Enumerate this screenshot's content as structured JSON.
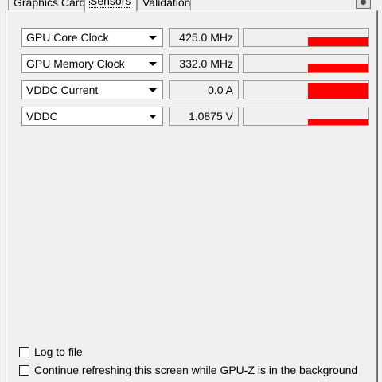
{
  "tabs": [
    {
      "label": "Graphics Card"
    },
    {
      "label": "Sensors"
    },
    {
      "label": "Validation"
    }
  ],
  "toolbar": {
    "screenshot_icon": "camera-icon"
  },
  "sensors": [
    {
      "name": "GPU Core Clock",
      "value": "425.0 MHz",
      "graph_level": 0.48
    },
    {
      "name": "GPU Memory Clock",
      "value": "332.0 MHz",
      "graph_level": 0.48
    },
    {
      "name": "VDDC Current",
      "value": "0.0 A",
      "graph_level": 0.9
    },
    {
      "name": "VDDC",
      "value": "1.0875 V",
      "graph_level": 0.33
    }
  ],
  "options": {
    "log_to_file": {
      "label": "Log to file",
      "checked": false
    },
    "background_refresh": {
      "label": "Continue refreshing this screen while GPU-Z is in the background",
      "checked": false
    }
  },
  "colors": {
    "graph_bar": "#ff0000",
    "panel_bg": "#f0f0f0"
  }
}
